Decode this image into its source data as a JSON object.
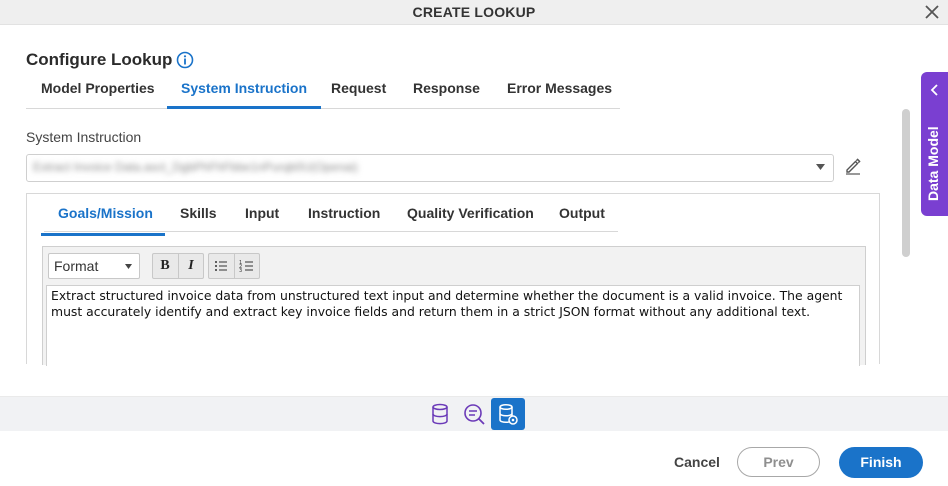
{
  "window": {
    "title": "CREATE LOOKUP",
    "close_icon": "close-icon"
  },
  "heading": {
    "title": "Configure Lookup",
    "icon": "info-icon"
  },
  "main_tabs": [
    {
      "label": "Model Properties",
      "active": false
    },
    {
      "label": "System Instruction",
      "active": true
    },
    {
      "label": "Request",
      "active": false
    },
    {
      "label": "Response",
      "active": false
    },
    {
      "label": "Error Messages",
      "active": false
    }
  ],
  "system_instruction": {
    "label": "System Instruction",
    "selected_value": "Extract Invoice Data.asct_DgbPhFhFbbe1nPurqb0U(Openai)",
    "edit_icon": "pencil-icon"
  },
  "sub_tabs": [
    {
      "label": "Goals/Mission",
      "active": true
    },
    {
      "label": "Skills",
      "active": false
    },
    {
      "label": "Input",
      "active": false
    },
    {
      "label": "Instruction",
      "active": false
    },
    {
      "label": "Quality Verification",
      "active": false
    },
    {
      "label": "Output",
      "active": false
    }
  ],
  "editor": {
    "format_label": "Format",
    "toolbar": {
      "bold": "B",
      "italic": "I",
      "bullet_list_icon": "bulleted-list-icon",
      "numbered_list_icon": "numbered-list-icon"
    },
    "content": "Extract structured invoice data from unstructured text input and determine whether the document is a valid invoice. The agent must accurately identify and extract key invoice fields and return them in a strict JSON format without any additional text."
  },
  "side_panel": {
    "label": "Data Model",
    "icon": "chevron-left-icon",
    "color": "#7a3fd1"
  },
  "icon_bar": [
    "database-icon",
    "search-query-icon",
    "database-settings-icon"
  ],
  "footer": {
    "cancel": "Cancel",
    "prev": "Prev",
    "finish": "Finish"
  },
  "colors": {
    "accent": "#1a73c9",
    "purple": "#7a3fd1"
  }
}
